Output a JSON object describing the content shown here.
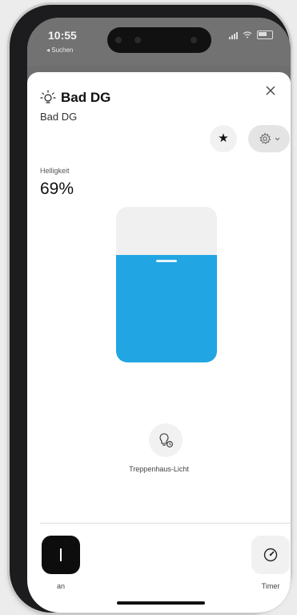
{
  "status_bar": {
    "time": "10:55",
    "back_label": "◂ Suchen"
  },
  "header": {
    "title": "Bad DG",
    "subtitle": "Bad DG",
    "icon": "light-bulb-icon"
  },
  "actions": {
    "favorite_icon": "star-icon",
    "settings_icon": "gear-icon",
    "settings_dropdown_icon": "chevron-down-icon",
    "close_icon": "close-icon"
  },
  "brightness": {
    "label": "Helligkeit",
    "value_text": "69%",
    "level_percent": 69,
    "fill_color": "#21a6e3"
  },
  "scene": {
    "label": "Treppenhaus-Licht",
    "icon": "bulb-timer-icon"
  },
  "controls": {
    "power_label": "an",
    "timer_label": "Timer",
    "timer_icon": "gauge-icon"
  }
}
